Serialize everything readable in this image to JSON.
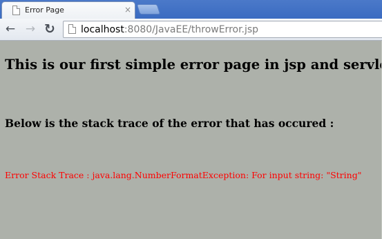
{
  "tab": {
    "title": "Error Page",
    "favicon_icon": "page-icon",
    "close_glyph": "×"
  },
  "toolbar": {
    "back_glyph": "←",
    "forward_glyph": "→",
    "reload_glyph": "↻"
  },
  "address_bar": {
    "host": "localhost",
    "rest": ":8080/JavaEE/throwError.jsp",
    "page_icon": "page-icon"
  },
  "page": {
    "heading": "This is our first simple error page in jsp and servlet",
    "subheading": "Below is the stack trace of the error that has occured :",
    "error_trace": "Error Stack Trace : java.lang.NumberFormatException: For input string: \"String\""
  },
  "colors": {
    "page_background": "#adb1aa",
    "error_text": "#ff0000",
    "tab_strip": "#3a6bc1"
  }
}
